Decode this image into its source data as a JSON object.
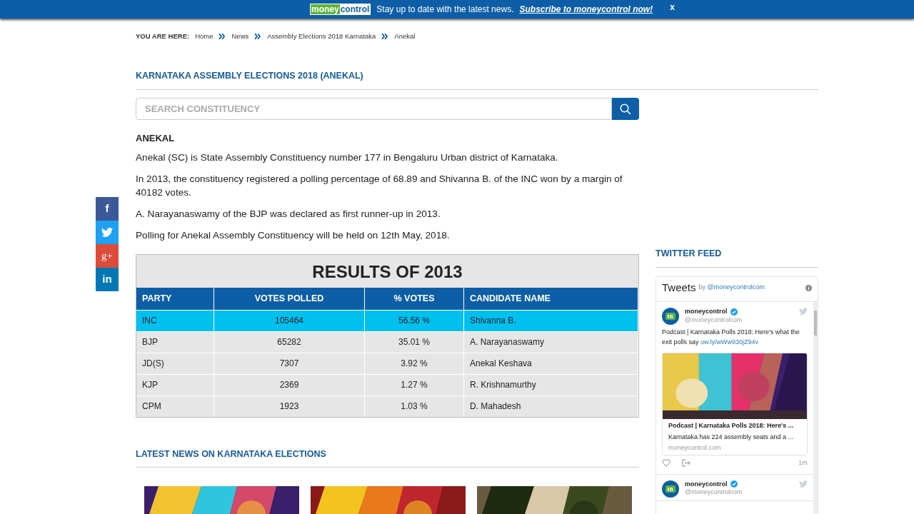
{
  "banner": {
    "logo_left": "money",
    "logo_right": "control",
    "message": "Stay up to date with the latest news.",
    "link": "Subscribe to moneycontrol now!",
    "close": "x"
  },
  "breadcrumb": {
    "label": "YOU ARE HERE:",
    "items": [
      "Home",
      "News",
      "Assembly Elections 2018 Karnataka",
      "Anekal"
    ]
  },
  "page_title": "KARNATAKA ASSEMBLY ELECTIONS 2018 (ANEKAL)",
  "search": {
    "placeholder": "SEARCH CONSTITUENCY"
  },
  "constituency": {
    "name": "ANEKAL",
    "paragraphs": [
      "Anekal (SC) is State Assembly Constituency number 177 in Bengaluru Urban district of Karnataka.",
      "In 2013, the constituency registered a polling percentage of 68.89 and Shivanna B. of the INC won by a margin of 40182 votes.",
      "A. Narayanaswamy of the BJP was declared as first runner-up in 2013.",
      "Polling for Anekal Assembly Constituency will be held on 12th May, 2018."
    ]
  },
  "social": [
    {
      "kind": "facebook",
      "label": "f"
    },
    {
      "kind": "twitter"
    },
    {
      "kind": "googleplus",
      "label": "g+"
    },
    {
      "kind": "linkedin",
      "label": "in"
    }
  ],
  "results": {
    "title": "RESULTS OF 2013",
    "columns": [
      "PARTY",
      "VOTES POLLED",
      "% VOTES",
      "CANDIDATE NAME"
    ],
    "rows": [
      {
        "cells": [
          "INC",
          "105464",
          "56.56 %",
          "Shivanna B."
        ],
        "selected": true
      },
      {
        "cells": [
          "BJP",
          "65282",
          "35.01 %",
          "A. Narayanaswamy"
        ],
        "selected": false
      },
      {
        "cells": [
          "JD(S)",
          "7307",
          "3.92 %",
          "Anekal Keshava"
        ],
        "selected": false
      },
      {
        "cells": [
          "KJP",
          "2369",
          "1.27 %",
          "R. Krishnamurthy"
        ],
        "selected": false
      },
      {
        "cells": [
          "CPM",
          "1923",
          "1.03 %",
          "D. Mahadesh"
        ],
        "selected": false
      }
    ]
  },
  "latest_news": {
    "title": "LATEST NEWS ON KARNATAKA ELECTIONS"
  },
  "twitter": {
    "section_title": "TWITTER FEED",
    "header": "Tweets",
    "by": "by",
    "handle": "@moneycontrolcom",
    "tweets": [
      {
        "name": "moneycontrol",
        "handle": "@moneycontrolcom",
        "text": "Podcast | Karnataka Polls 2018: Here's what the exit polls say",
        "link": "ow.ly/wWw930jZ94v",
        "card": {
          "title": "Podcast | Karnataka Polls 2018: Here's ...",
          "description": "Karnataka has 224 assembly seats and a ...",
          "domain": "moneycontrol.com"
        },
        "time": "1m"
      },
      {
        "name": "moneycontrol",
        "handle": "@moneycontrolcom"
      }
    ]
  }
}
